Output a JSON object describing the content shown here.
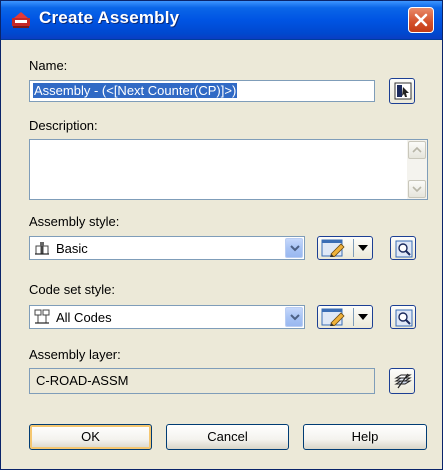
{
  "dialog": {
    "title": "Create Assembly"
  },
  "name": {
    "label": "Name:",
    "value": "Assembly - (<[Next Counter(CP)]>)"
  },
  "description": {
    "label": "Description:",
    "value": ""
  },
  "assembly_style": {
    "label": "Assembly style:",
    "selected": "Basic",
    "icon": "assembly-style-icon"
  },
  "code_set_style": {
    "label": "Code set style:",
    "selected": "All Codes",
    "icon": "code-set-icon"
  },
  "assembly_layer": {
    "label": "Assembly layer:",
    "value": "C-ROAD-ASSM"
  },
  "buttons": {
    "ok": "OK",
    "cancel": "Cancel",
    "help": "Help"
  },
  "colors": {
    "titlebar": "#0054e3",
    "selection": "#316ac5",
    "dialog_bg": "#ece9d8"
  }
}
